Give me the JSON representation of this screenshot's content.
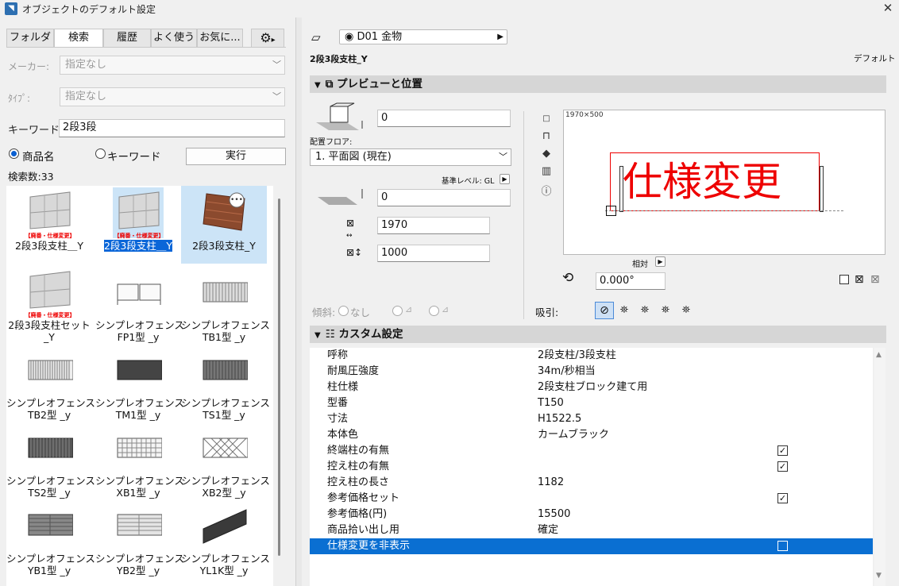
{
  "window": {
    "title": "オブジェクトのデフォルト設定",
    "close": "✕"
  },
  "left": {
    "tabs": [
      "フォルダ",
      "検索",
      "履歴",
      "よく使う",
      "お気に..."
    ],
    "maker_label": "メーカー:",
    "maker_value": "指定なし",
    "type_label": "ﾀｲﾌﾟ:",
    "type_value": "指定なし",
    "keyword_label": "キーワード:",
    "keyword_value": "2段3段",
    "radio1": "商品名",
    "radio2": "キーワード",
    "exec": "実行",
    "count": "検索数:33",
    "items": [
      {
        "name": "2段3段支柱＿Y",
        "tag": "【廃番・仕様変更】"
      },
      {
        "name": "2段3段支柱＿Y",
        "tag": "【廃番・仕様変更】"
      },
      {
        "name": "2段3段支柱_Y",
        "tag": ""
      },
      {
        "name": "2段3段支柱セット\n_Y",
        "tag": "【廃番・仕様変更】"
      },
      {
        "name": "シンプレオフェンス\nFP1型 _y",
        "tag": ""
      },
      {
        "name": "シンプレオフェンス\nTB1型 _y",
        "tag": ""
      },
      {
        "name": "シンプレオフェンス\nTB2型 _y",
        "tag": ""
      },
      {
        "name": "シンプレオフェンス\nTM1型 _y",
        "tag": ""
      },
      {
        "name": "シンプレオフェンス\nTS1型 _y",
        "tag": ""
      },
      {
        "name": "シンプレオフェンス\nTS2型 _y",
        "tag": ""
      },
      {
        "name": "シンプレオフェンス\nXB1型 _y",
        "tag": ""
      },
      {
        "name": "シンプレオフェンス\nXB2型 _y",
        "tag": ""
      },
      {
        "name": "シンプレオフェンス\nYB1型 _y",
        "tag": ""
      },
      {
        "name": "シンプレオフェンス\nYB2型 _y",
        "tag": ""
      },
      {
        "name": "シンプレオフェンス\nYL1K型 _y",
        "tag": ""
      }
    ]
  },
  "right": {
    "layer": "D01 金物",
    "object_name": "2段3段支柱_Y",
    "default_label": "デフォルト",
    "sec1": "プレビューと位置",
    "offset": "0",
    "floor_label": "配置フロア:",
    "floor": "1. 平面図 (現在)",
    "ref_level": "基準レベル: GL",
    "elev": "0",
    "width": "1970",
    "height": "1000",
    "preview_size": "1970×500",
    "preview_text": "仕様変更",
    "relative": "相対",
    "angle": "0.000°",
    "slope_label": "傾斜:",
    "slope_none": "なし",
    "snap_label": "吸引:",
    "sec2": "カスタム設定",
    "rows": [
      {
        "k": "呼称",
        "v": "2段支柱/3段支柱",
        "cb": ""
      },
      {
        "k": "耐風圧強度",
        "v": "34m/秒相当",
        "cb": ""
      },
      {
        "k": "柱仕様",
        "v": "2段支柱ブロック建て用",
        "cb": ""
      },
      {
        "k": "型番",
        "v": "T150",
        "cb": ""
      },
      {
        "k": "寸法",
        "v": "H1522.5",
        "cb": ""
      },
      {
        "k": "本体色",
        "v": "カームブラック",
        "cb": ""
      },
      {
        "k": "終端柱の有無",
        "v": "",
        "cb": "on"
      },
      {
        "k": "控え柱の有無",
        "v": "",
        "cb": "on"
      },
      {
        "k": "控え柱の長さ",
        "v": "1182",
        "cb": ""
      },
      {
        "k": "参考価格セット",
        "v": "",
        "cb": "on"
      },
      {
        "k": "参考価格(円)",
        "v": "15500",
        "cb": ""
      },
      {
        "k": "商品拾い出し用",
        "v": "確定",
        "cb": ""
      },
      {
        "k": "仕様変更を非表示",
        "v": "",
        "cb": "off"
      }
    ]
  },
  "colors": {
    "accent": "#0a6fd2",
    "red": "#e00000"
  }
}
